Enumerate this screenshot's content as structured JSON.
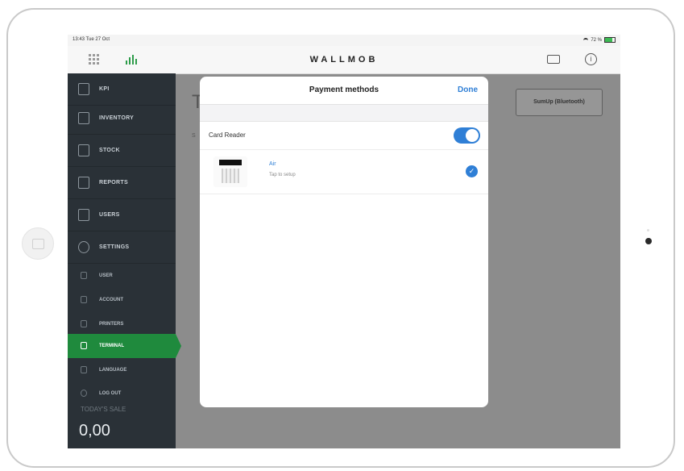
{
  "status": {
    "time": "13:43  Tue 27 Oct",
    "battery": "72 %"
  },
  "navbar": {
    "brand": "WALLMOB",
    "icons": [
      "grid-icon",
      "signal-icon",
      "printer-icon",
      "info-icon"
    ]
  },
  "sidebar": {
    "items": [
      {
        "label": "KPI",
        "icon": "kpi-icon"
      },
      {
        "label": "INVENTORY",
        "icon": "inventory-icon"
      },
      {
        "label": "STOCK",
        "icon": "stock-icon"
      },
      {
        "label": "REPORTS",
        "icon": "reports-icon"
      },
      {
        "label": "USERS",
        "icon": "users-icon"
      },
      {
        "label": "SETTINGS",
        "icon": "gear-icon"
      }
    ],
    "subitems": [
      {
        "label": "USER",
        "icon": "user-icon"
      },
      {
        "label": "ACCOUNT",
        "icon": "account-icon"
      },
      {
        "label": "PRINTERS",
        "icon": "printer-icon"
      },
      {
        "label": "TERMINAL",
        "icon": "terminal-icon",
        "active": true
      },
      {
        "label": "LANGUAGE",
        "icon": "language-icon"
      },
      {
        "label": "LOG OUT",
        "icon": "logout-icon"
      }
    ],
    "today_label": "TODAY'S SALE",
    "today_value": "0,00"
  },
  "background": {
    "title_fragment": "T",
    "subtitle_fragment": "S",
    "sumup_button": "SumUp (Bluetooth)"
  },
  "modal": {
    "title": "Payment methods",
    "done_label": "Done",
    "card_reader_label": "Card Reader",
    "card_reader_enabled": true,
    "device": {
      "name": "Air",
      "subtitle": "Tap to setup",
      "selected": true
    }
  },
  "colors": {
    "accent": "#2f7fd6",
    "active": "#1f8a3d",
    "sidebar": "#2a3137"
  }
}
